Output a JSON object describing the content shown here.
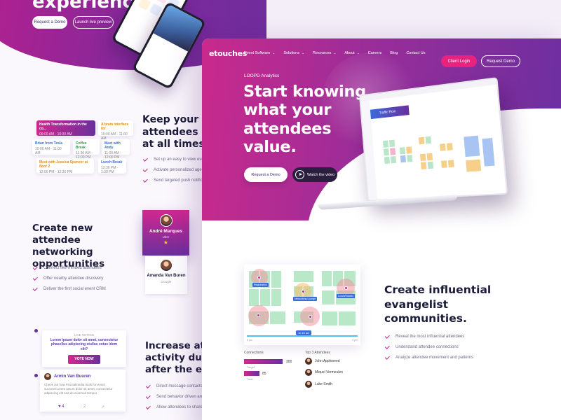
{
  "back": {
    "hero_title": "experiences.",
    "btn_demo": "Request a Demo",
    "btn_live": "Launch live preview",
    "schedule": {
      "main_title": "Health Transformation in the co...",
      "main_time": "09:00 AM - 10:00 AM",
      "items": [
        {
          "title": "A brain interface for",
          "time": "10:00 AM - 11:00 AM"
        },
        {
          "title": "Brian from Tesla",
          "time": "10:00 AM - 11:00 AM"
        },
        {
          "title": "Coffee Break",
          "time": "11:30 AM - 12:00 PM"
        },
        {
          "title": "Meet with Andy",
          "time": "11:00 AM - 12:00 PM"
        },
        {
          "title": "Meet with Jessica Spencer at floor 2",
          "time": "12:00 PM - 12:30 PM"
        },
        {
          "title": "Lunch Break",
          "time": "12:30 PM - 1:30 PM"
        }
      ]
    },
    "keep_title": "Keep your attendees in at all times.",
    "keep_items": [
      "Set up an easy to view event",
      "Activate personalized agend",
      "Send targeted push notificati"
    ],
    "network_title": "Create new attendee networking opportunities",
    "network_items": [
      "Connect like-minded attendees",
      "Offer nearby attendee discovery",
      "Deliver the first social event CRM"
    ],
    "person1": {
      "name": "André Marques",
      "role": "Uber"
    },
    "person2": {
      "name": "Amanda Van Buren",
      "role": "Google"
    },
    "vote": {
      "label": "LIVE VOTING",
      "question": "Lorem ipsum dolor sit amet, consectetur phasellus adipiscing stullus estus idem elit?",
      "button": "VOTE NOW"
    },
    "post": {
      "name": "Armin Van Buuren",
      "text": "Check out how #socialmedia tools for event success!Lorem ipsum dolor sit amet, consectetur adipiscing elit sed do eiusmod tempor.",
      "likes": "4",
      "comments": "2"
    },
    "increase_title": "Increase atte activity duri after the eve",
    "increase_items": [
      "Direct message contacts",
      "Send behavior driven annou",
      "Allow attendees to share co"
    ]
  },
  "front": {
    "logo": "etouches",
    "nav": [
      "Event Software",
      "Solutions",
      "Resources",
      "About",
      "Careers",
      "Blog",
      "Contact Us"
    ],
    "nav_has_caret": [
      true,
      true,
      true,
      true,
      false,
      false,
      false
    ],
    "btn_login": "Client Login",
    "btn_request": "Request Demo",
    "eyebrow": "LOOPD Analytics",
    "hero_title": "Start knowing what your attendees value.",
    "btn_hero_demo": "Request a Demo",
    "btn_hero_video": "Watch the video",
    "laptop_label": "Traffic Flow",
    "map": {
      "tags": [
        "Registration",
        "Networking Lounge",
        "Lunch/Snacks"
      ],
      "time": "11:15 am",
      "start": "8 am",
      "end": "5 pm"
    },
    "connections": {
      "title": "Connections",
      "rows": [
        {
          "label": "Target",
          "value": "300"
        },
        {
          "label": "Total",
          "value": "85"
        }
      ]
    },
    "attendees": {
      "title": "Top 3 Attendees",
      "names": [
        "John Appleseed",
        "Miquel Vermeulen",
        "Luke Smith"
      ]
    },
    "evan_title": "Create influential evangelist communities.",
    "evan_items": [
      "Reveal the most influential attendees",
      "Understand attendee connections",
      "Analyze attendee movement and patterns"
    ]
  }
}
